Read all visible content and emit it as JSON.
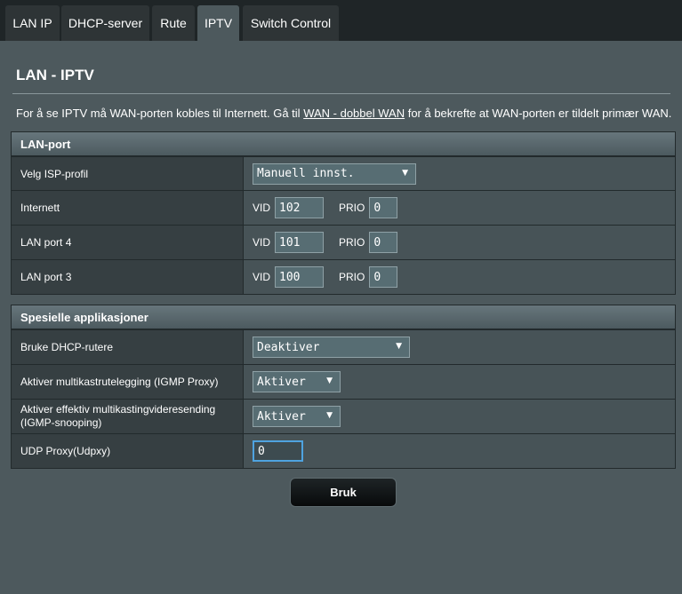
{
  "tabs": [
    {
      "label": "LAN IP"
    },
    {
      "label": "DHCP-server"
    },
    {
      "label": "Rute"
    },
    {
      "label": "IPTV"
    },
    {
      "label": "Switch Control"
    }
  ],
  "page": {
    "title": "LAN - IPTV",
    "desc_pre": "For å se IPTV må WAN-porten kobles til Internett. Gå til ",
    "desc_link": "WAN - dobbel WAN",
    "desc_post": " for å bekrefte at WAN-porten er tildelt primær WAN."
  },
  "lan_port": {
    "header": "LAN-port",
    "isp_label": "Velg ISP-profil",
    "isp_value": "Manuell innst.",
    "vid_label": "VID",
    "prio_label": "PRIO",
    "rows": [
      {
        "label": "Internett",
        "vid": "102",
        "prio": "0"
      },
      {
        "label": "LAN port 4",
        "vid": "101",
        "prio": "0"
      },
      {
        "label": "LAN port 3",
        "vid": "100",
        "prio": "0"
      }
    ]
  },
  "special": {
    "header": "Spesielle applikasjoner",
    "dhcp_label": "Bruke DHCP-rutere",
    "dhcp_value": "Deaktiver",
    "igmp_proxy_label": "Aktiver multikastrutelegging (IGMP Proxy)",
    "igmp_proxy_value": "Aktiver",
    "igmp_snoop_label": "Aktiver effektiv multikastingvideresending (IGMP-snooping)",
    "igmp_snoop_value": "Aktiver",
    "udpxy_label": "UDP Proxy(Udpxy)",
    "udpxy_value": "0"
  },
  "apply_label": "Bruk"
}
